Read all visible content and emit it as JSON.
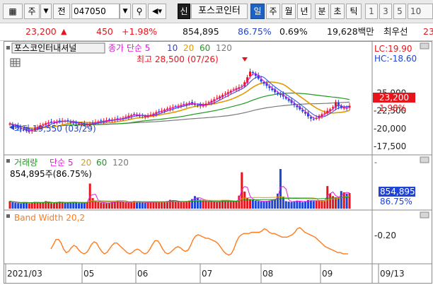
{
  "toolbar": {
    "stock_letter": "주",
    "period_button": "전",
    "code": "047050",
    "new_badge": "신",
    "stock_name": "포스코인터",
    "periods": [
      "일",
      "주",
      "월",
      "년",
      "분",
      "초",
      "틱"
    ],
    "numbers": [
      "1",
      "3",
      "5",
      "10"
    ]
  },
  "quote": {
    "price": "23,200",
    "change": "450",
    "change_pct": "+1.98%",
    "volume": "854,895",
    "volume_ratio": "86.75%",
    "turnover": "0.69%",
    "amount": "19,628백만",
    "best_offer_label": "최우선",
    "best_offer_value": "23"
  },
  "colors": {
    "up": "#e8141c",
    "down": "#1f44d8",
    "ma5": "#e11adb",
    "ma10": "#2b44e0",
    "ma20": "#e09b00",
    "ma60": "#1f9a1f",
    "ma120": "#7a7a7a",
    "bandwidth": "#ff7a1a"
  },
  "chart_data": [
    {
      "type": "candlestick",
      "title": "포스코인터내셔널",
      "legend": [
        "종가 단순 5",
        "10",
        "20",
        "60",
        "120"
      ],
      "ylim": [
        16700,
        30200
      ],
      "yticks": [
        17500,
        20000,
        22500,
        25000
      ],
      "ytick_labels": [
        "-17,500",
        "-20,000",
        "-22,500",
        "-25,000"
      ],
      "lc_label": "LC:19.90",
      "hc_label": "HC:-18.60",
      "current_price_label": "23,200",
      "current_change_label": "1.98%",
      "high_annotation": "최고 28,500 (07/26)",
      "low_annotation": "최저 19,550 (03/29)",
      "x_labels": [
        "2021/03",
        "05",
        "06",
        "07",
        "08",
        "09",
        "09/13"
      ],
      "close": [
        20700,
        20450,
        20300,
        20100,
        19950,
        19800,
        19650,
        19700,
        19850,
        20000,
        20200,
        20400,
        20600,
        20750,
        20850,
        20900,
        20950,
        21000,
        21050,
        21100,
        21050,
        21000,
        20900,
        20800,
        20700,
        20650,
        20600,
        20550,
        20600,
        20700,
        20800,
        20900,
        21000,
        21050,
        21100,
        21150,
        21200,
        21250,
        21300,
        21350,
        21400,
        21500,
        21650,
        21800,
        21900,
        22000,
        21900,
        21800,
        21750,
        21700,
        21800,
        21950,
        22100,
        22300,
        22400,
        22500,
        22650,
        22800,
        22900,
        23000,
        23100,
        23200,
        23300,
        23400,
        23500,
        23600,
        23500,
        23400,
        23300,
        23200,
        23300,
        23500,
        23700,
        23900,
        24100,
        24300,
        24500,
        24700,
        24900,
        25100,
        25300,
        25500,
        25650,
        25800,
        26000,
        26500,
        27200,
        28000,
        27800,
        27400,
        27000,
        26600,
        26300,
        26000,
        25700,
        25400,
        25100,
        24900,
        24700,
        24500,
        24200,
        23900,
        23600,
        23300,
        23000,
        22700,
        22400,
        22100,
        21700,
        21400,
        21300,
        21500,
        21800,
        22000,
        22200,
        22500,
        22700,
        23000,
        23700,
        23100,
        22900,
        23000,
        22800,
        23200
      ]
    },
    {
      "type": "bar",
      "title": "거래량",
      "legend": [
        "단순 5",
        "20",
        "60",
        "120"
      ],
      "volume_label": "854,895주(86.75%)",
      "current_volume_label": "854,895",
      "current_ratio_label": "86.75%",
      "values": [
        300,
        260,
        240,
        220,
        200,
        260,
        230,
        210,
        250,
        270,
        240,
        230,
        260,
        300,
        240,
        220,
        210,
        260,
        280,
        240,
        230,
        250,
        270,
        260,
        240,
        220,
        210,
        250,
        260,
        1000,
        420,
        300,
        260,
        240,
        220,
        210,
        230,
        250,
        270,
        300,
        280,
        260,
        240,
        230,
        260,
        300,
        280,
        260,
        240,
        230,
        260,
        250,
        240,
        260,
        280,
        270,
        260,
        300,
        350,
        320,
        300,
        280,
        270,
        260,
        300,
        320,
        380,
        500,
        420,
        360,
        340,
        320,
        300,
        280,
        270,
        260,
        300,
        340,
        320,
        300,
        280,
        290,
        300,
        520,
        1450,
        680,
        420,
        380,
        340,
        320,
        300,
        280,
        290,
        300,
        320,
        350,
        380,
        600,
        1580,
        480,
        300,
        280,
        260,
        300,
        320,
        280,
        260,
        300,
        340,
        320,
        300,
        320,
        340,
        320,
        300,
        900,
        600,
        500,
        450,
        420,
        700,
        650,
        600,
        620
      ]
    },
    {
      "type": "line",
      "title": "Band Width 20,2",
      "ytick_labels": [
        "-0.20"
      ],
      "values": [
        0.14,
        0.18,
        0.22,
        0.22,
        0.19,
        0.14,
        0.11,
        0.12,
        0.15,
        0.17,
        0.16,
        0.13,
        0.11,
        0.1,
        0.11,
        0.14,
        0.18,
        0.2,
        0.19,
        0.15,
        0.12,
        0.1,
        0.11,
        0.14,
        0.17,
        0.19,
        0.19,
        0.17,
        0.15,
        0.13,
        0.11,
        0.1,
        0.11,
        0.13,
        0.14,
        0.13,
        0.11,
        0.1,
        0.11,
        0.14,
        0.18,
        0.21,
        0.21,
        0.18,
        0.14,
        0.11,
        0.1,
        0.11,
        0.13,
        0.15,
        0.16,
        0.15,
        0.13,
        0.12,
        0.13,
        0.17,
        0.22,
        0.25,
        0.26,
        0.25,
        0.24,
        0.23,
        0.23,
        0.22,
        0.21,
        0.2,
        0.18,
        0.15,
        0.12,
        0.1,
        0.09,
        0.1,
        0.14,
        0.2,
        0.24,
        0.26,
        0.27,
        0.27,
        0.27,
        0.28,
        0.28,
        0.28,
        0.28,
        0.29,
        0.31,
        0.3,
        0.28,
        0.27,
        0.27,
        0.26,
        0.25,
        0.24,
        0.24,
        0.24,
        0.25,
        0.26,
        0.28,
        0.31,
        0.32,
        0.3,
        0.28,
        0.27,
        0.26,
        0.25,
        0.24,
        0.22,
        0.2,
        0.18,
        0.16,
        0.15,
        0.14,
        0.13,
        0.12,
        0.11,
        0.11,
        0.1,
        0.1,
        0.1
      ],
      "ylim": [
        0.04,
        0.36
      ]
    }
  ]
}
